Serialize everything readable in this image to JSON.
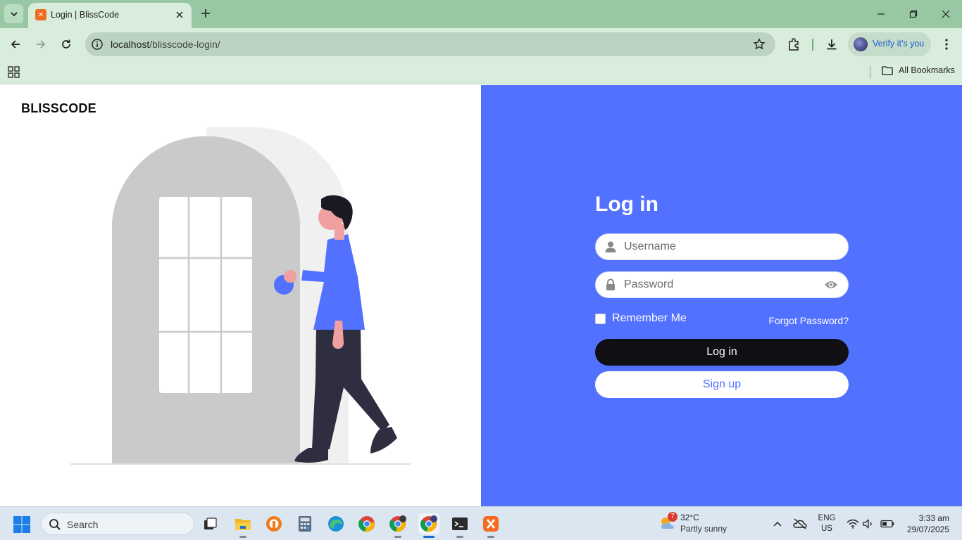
{
  "browser": {
    "tab_title": "Login | BlissCode",
    "url_host": "localhost",
    "url_path": "/blisscode-login/",
    "profile_label": "Verify it's you",
    "bookmarks_label": "All Bookmarks"
  },
  "page": {
    "brand": "BLISSCODE",
    "form": {
      "title": "Log in",
      "username_placeholder": "Username",
      "password_placeholder": "Password",
      "remember_label": "Remember Me",
      "remember_checked": false,
      "forgot_label": "Forgot Password?",
      "login_button": "Log in",
      "signup_button": "Sign up"
    },
    "colors": {
      "accent": "#5271ff",
      "login_button_bg": "#0f0f14",
      "door": "#cacaca"
    }
  },
  "taskbar": {
    "search_label": "Search",
    "weather": {
      "badge": "7",
      "temp": "32°C",
      "desc": "Partly sunny"
    },
    "language": {
      "line1": "ENG",
      "line2": "US"
    },
    "clock": {
      "time": "3:33 am",
      "date": "29/07/2025"
    },
    "apps": [
      "file-explorer-icon",
      "outlook-icon",
      "calculator-icon",
      "edge-icon",
      "chrome-icon",
      "chrome-profile-icon",
      "chrome-active-icon",
      "terminal-icon",
      "xampp-icon"
    ]
  }
}
